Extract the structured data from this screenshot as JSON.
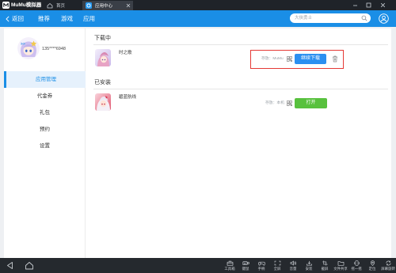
{
  "titlebar": {
    "app_name": "MuMu模拟器",
    "tabs": [
      {
        "label": "首页",
        "icon": "home-icon",
        "active": false
      },
      {
        "label": "应用中心",
        "icon": "app-center-icon",
        "active": true
      }
    ]
  },
  "navbar": {
    "back_label": "返回",
    "items": [
      {
        "label": "推荐"
      },
      {
        "label": "游戏"
      },
      {
        "label": "应用"
      }
    ],
    "search_placeholder": "大侠勇士"
  },
  "user": {
    "username": "135****6948"
  },
  "sidebar": {
    "items": [
      {
        "label": "应用管理",
        "active": true
      },
      {
        "label": "代金券",
        "active": false
      },
      {
        "label": "礼包",
        "active": false
      },
      {
        "label": "预约",
        "active": false
      },
      {
        "label": "设置",
        "active": false
      }
    ]
  },
  "downloading": {
    "title": "下载中",
    "apps": [
      {
        "name": "时之歌",
        "storage": "存放：MuMu",
        "action": "继续下载"
      }
    ]
  },
  "installed": {
    "title": "已安装",
    "apps": [
      {
        "name": "碧蓝航线",
        "storage": "存放：本机",
        "action": "打开"
      }
    ]
  },
  "toolbar": {
    "items": [
      {
        "label": "工具箱",
        "icon": "toolbox-icon"
      },
      {
        "label": "键鼠",
        "icon": "keyboard-mouse-icon"
      },
      {
        "label": "手柄",
        "icon": "gamepad-icon"
      },
      {
        "label": "全屏",
        "icon": "fullscreen-icon"
      },
      {
        "label": "音量",
        "icon": "volume-icon"
      },
      {
        "label": "安装",
        "icon": "install-icon"
      },
      {
        "label": "截屏",
        "icon": "screenshot-icon"
      },
      {
        "label": "文件共享",
        "icon": "folder-icon"
      },
      {
        "label": "摇一摇",
        "icon": "shake-icon"
      },
      {
        "label": "定位",
        "icon": "location-icon"
      },
      {
        "label": "屏幕旋转",
        "icon": "rotate-icon"
      }
    ]
  },
  "colors": {
    "accent": "#1a8ee6",
    "primary": "#2b8ff0",
    "open": "#58c13e",
    "highlight": "#e53935",
    "titlebar": "#1f2329",
    "toolbar": "#25292e"
  }
}
